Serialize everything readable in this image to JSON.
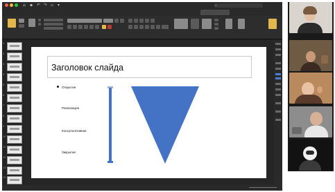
{
  "window": {
    "title": "",
    "search_placeholder": ""
  },
  "tabs": [
    "",
    "",
    "",
    "",
    "",
    "",
    "",
    "",
    "",
    ""
  ],
  "active_tab_index": 9,
  "slide": {
    "title": "Заголовок слайда",
    "bullets": [
      "Открытие",
      "Реализация",
      "Консультативная",
      "Закрытие"
    ]
  },
  "thumbnails": [
    "1",
    "2",
    "3",
    "4",
    "5",
    "6",
    "7",
    "8",
    "9",
    "10",
    "11",
    "12",
    "13",
    "14"
  ],
  "status": {
    "left": ""
  },
  "colors": {
    "shape_blue": "#4472c4",
    "slide_bg": "#ffffff",
    "app_bg": "#1f1f1f",
    "accent": "#e2b84a"
  },
  "video_participants": [
    "participant-1",
    "participant-2",
    "participant-3",
    "participant-4",
    "participant-5"
  ]
}
